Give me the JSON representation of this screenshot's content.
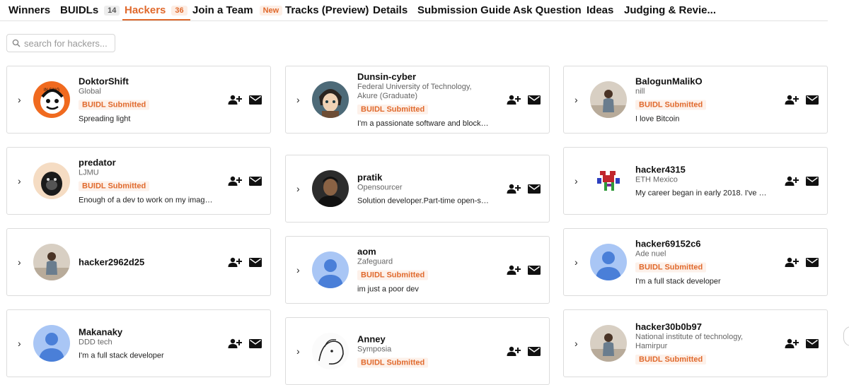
{
  "tabs": [
    {
      "label": "Winners"
    },
    {
      "label": "BUIDLs",
      "count": "14"
    },
    {
      "label": "Hackers",
      "count": "36"
    },
    {
      "label": "Join a Team",
      "badge": "New"
    },
    {
      "label": "Tracks (Preview)"
    },
    {
      "label": "Details"
    },
    {
      "label": "Submission Guide"
    },
    {
      "label": "Ask Question"
    },
    {
      "label": "Ideas"
    },
    {
      "label": "Judging & Revie..."
    }
  ],
  "search": {
    "placeholder": "search for hackers..."
  },
  "colors": {
    "accent": "#e0692c",
    "badge_bg": "#fdf1ea"
  },
  "hackers": [
    {
      "name": "DoktorShift",
      "affiliation": "Global",
      "badge": "BUIDL Submitted",
      "bio": "Spreading light",
      "avatar": "orange-comic-avatar"
    },
    {
      "name": "predator",
      "affiliation": "LJMU",
      "badge": "BUIDL Submitted",
      "bio": "Enough of a dev to work on my imaginati...",
      "avatar": "gorilla-avatar"
    },
    {
      "name": "hacker2962d25",
      "avatar": "person-photo-avatar"
    },
    {
      "name": "Makanaky",
      "affiliation": "DDD tech",
      "bio": "I'm a full stack developer",
      "avatar": "default-user-avatar"
    },
    {
      "name": "Dunsin-cyber",
      "affiliation": "Federal University of Technology, Akure (Graduate)",
      "badge": "BUIDL Submitted",
      "bio": "I'm a passionate software and blockchain ...",
      "avatar": "anime-avatar"
    },
    {
      "name": "pratik",
      "affiliation": "Opensourcer",
      "bio": "Solution developer.Part-time open-source...",
      "avatar": "portrait-avatar"
    },
    {
      "name": "aom",
      "affiliation": "Zafeguard",
      "badge": "BUIDL Submitted",
      "bio": "im just a poor dev",
      "avatar": "default-user-avatar"
    },
    {
      "name": "Anney",
      "affiliation": "Symposia",
      "badge": "BUIDL Submitted",
      "avatar": "sketch-avatar"
    },
    {
      "name": "BalogunMalikO",
      "affiliation": "nill",
      "badge": "BUIDL Submitted",
      "bio": "I love Bitcoin",
      "avatar": "person-photo-avatar"
    },
    {
      "name": "hacker4315",
      "affiliation": "ETH Mexico",
      "bio": "My career began in early 2018. I've given ...",
      "avatar": "pixel-art-avatar"
    },
    {
      "name": "hacker69152c6",
      "affiliation": "Ade nuel",
      "badge": "BUIDL Submitted",
      "bio": "I'm a full stack developer",
      "avatar": "default-user-avatar"
    },
    {
      "name": "hacker30b0b97",
      "affiliation": "National institute of technology, Hamirpur",
      "badge": "BUIDL Submitted",
      "avatar": "person-photo-avatar"
    }
  ]
}
